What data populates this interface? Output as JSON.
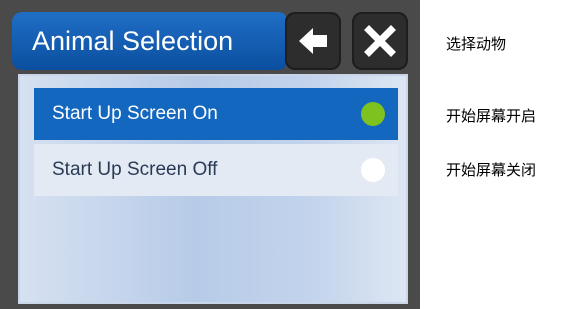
{
  "header": {
    "title": "Animal Selection",
    "back_icon": "arrow-left-icon",
    "close_icon": "close-icon"
  },
  "options": [
    {
      "label": "Start Up Screen On",
      "selected": true,
      "indicator_color": "#7dc21e"
    },
    {
      "label": "Start Up Screen Off",
      "selected": false,
      "indicator_color": "#ffffff"
    }
  ],
  "annotations": {
    "title": "选择动物",
    "option_on": "开始屏幕开启",
    "option_off": "开始屏幕关闭"
  },
  "colors": {
    "title_bar": "#0b4f9f",
    "selected_row": "#1367bf",
    "panel": "#c2d3ec",
    "device_frame": "#4a4a4a"
  }
}
